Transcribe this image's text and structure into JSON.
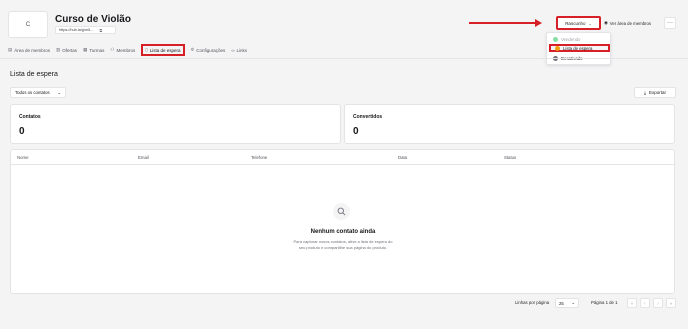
{
  "header": {
    "thumb_letter": "C",
    "title": "Curso de Violão",
    "url": "https://hub.la/g/m5...",
    "copy_icon": "copy-icon",
    "status_button": "Rascunho",
    "view_members": "Ver área de membros",
    "more": "···"
  },
  "status_menu": {
    "options": [
      {
        "label": "Vendendo",
        "color": "#22c55e"
      },
      {
        "label": "Lista de espera",
        "color": "#f59e0b"
      },
      {
        "label": "Desativado",
        "color": "#71717a"
      }
    ]
  },
  "tabs": [
    {
      "label": "Área de membros",
      "icon": "members-area-icon"
    },
    {
      "label": "Ofertas",
      "icon": "offers-icon"
    },
    {
      "label": "Turmas",
      "icon": "classes-icon"
    },
    {
      "label": "Membros",
      "icon": "users-icon"
    },
    {
      "label": "Lista de espera",
      "icon": "waitlist-icon",
      "active": true
    },
    {
      "label": "Configurações",
      "icon": "gear-icon"
    },
    {
      "label": "Links",
      "icon": "link-icon"
    }
  ],
  "section": {
    "title": "Lista de espera",
    "filter": "Todos os contatos",
    "export": "Exportar"
  },
  "cards": [
    {
      "label": "Contatos",
      "value": "0"
    },
    {
      "label": "Convertidos",
      "value": "0"
    }
  ],
  "table": {
    "columns": [
      "Nome",
      "Email",
      "Telefone",
      "Data",
      "Status"
    ],
    "empty_title": "Nenhum contato ainda",
    "empty_desc": "Para capturar novos contatos, ative a lista de espera do seu produto e compartilhe sua página do produto."
  },
  "pagination": {
    "rows_label": "Linhas por página",
    "rows_value": "25",
    "page_info": "Página 1 de 1",
    "first": "«",
    "prev": "‹",
    "next": "›",
    "last": "»"
  },
  "colors": {
    "highlight": "#d61f26",
    "background": "#f4f4f5"
  }
}
